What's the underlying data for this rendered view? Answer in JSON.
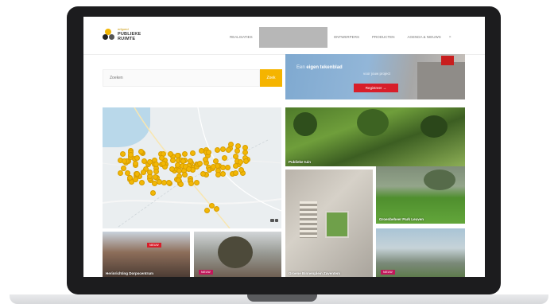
{
  "site": {
    "logo": {
      "top": "erfgoed",
      "line1": "PUBLIEKE",
      "line2": "RUIMTE"
    },
    "nav": [
      {
        "label": "REALISATIES",
        "active": false
      },
      {
        "label": "",
        "active": true
      },
      {
        "label": "ONTWERPERS",
        "active": false
      },
      {
        "label": "PRODUCTEN",
        "active": false
      },
      {
        "label": "AGENDA & NIEUWS",
        "active": false
      }
    ],
    "nav_close": "×"
  },
  "search": {
    "placeholder": "Zoeken",
    "button_label": "Zoek"
  },
  "promo": {
    "line1_prefix": "Een ",
    "line1_bold": "eigen tekenblad",
    "line2": "voor jouw project",
    "cta": "Registreer →"
  },
  "tiles": {
    "garden": {
      "caption": "Publieke tuin"
    },
    "aerial": {
      "caption": "Groene Binnenplein Zaventem"
    },
    "lawn": {
      "caption": "Groenbeheer Park Leuven"
    },
    "modern": {
      "badge": "NIEUW"
    },
    "row_a": {
      "caption": "Herinrichting Dorpscentrum",
      "badge": "NIEUW"
    },
    "row_b": {
      "badge": "NIEUW"
    }
  },
  "colors": {
    "accent": "#f5b400",
    "cta_red": "#d81e2a",
    "marker": "#f2b705"
  }
}
